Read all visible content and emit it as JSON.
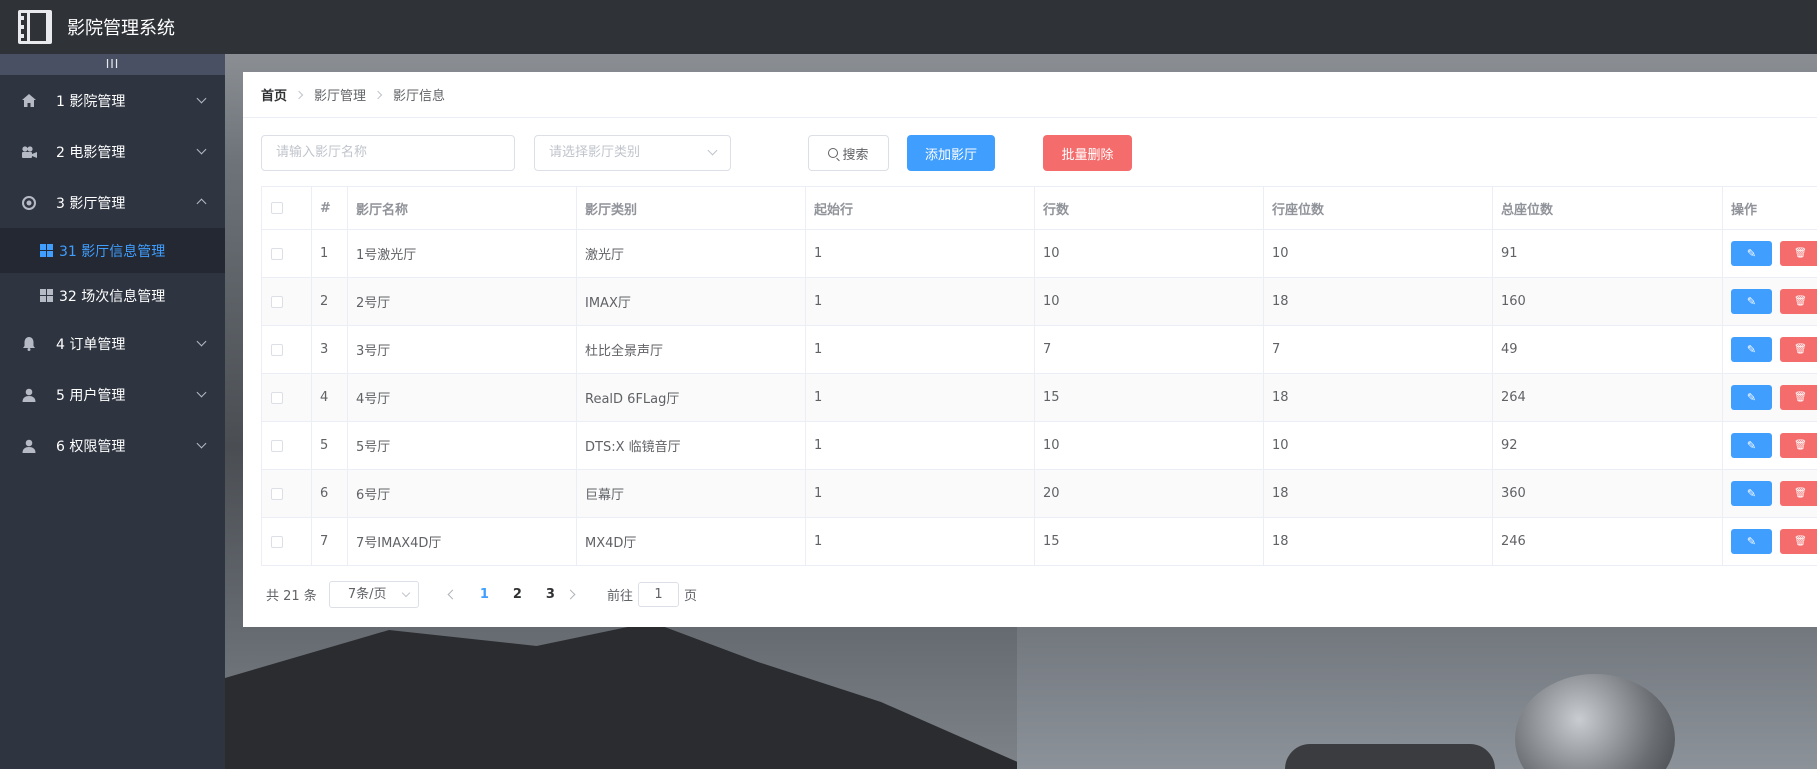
{
  "app": {
    "title": "影院管理系统"
  },
  "sidebar": {
    "collapse_label": "III",
    "items": [
      {
        "label": "1 影院管理",
        "icon": "home-icon",
        "expanded": false
      },
      {
        "label": "2 电影管理",
        "icon": "camera-icon",
        "expanded": false
      },
      {
        "label": "3 影厅管理",
        "icon": "circle-dot-icon",
        "expanded": true,
        "children": [
          {
            "label": "31 影厅信息管理",
            "active": true
          },
          {
            "label": "32 场次信息管理",
            "active": false
          }
        ]
      },
      {
        "label": "4 订单管理",
        "icon": "bell-icon",
        "expanded": false
      },
      {
        "label": "5 用户管理",
        "icon": "user-icon",
        "expanded": false
      },
      {
        "label": "6 权限管理",
        "icon": "user-icon",
        "expanded": false
      }
    ]
  },
  "breadcrumb": [
    "首页",
    "影厅管理",
    "影厅信息"
  ],
  "toolbar": {
    "name_placeholder": "请输入影厅名称",
    "type_placeholder": "请选择影厅类别",
    "search_label": "搜索",
    "add_label": "添加影厅",
    "bulk_delete_label": "批量删除"
  },
  "table": {
    "headers": [
      "#",
      "影厅名称",
      "影厅类别",
      "起始行",
      "行数",
      "行座位数",
      "总座位数",
      "操作"
    ],
    "rows": [
      [
        "1",
        "1号激光厅",
        "激光厅",
        "1",
        "10",
        "10",
        "91"
      ],
      [
        "2",
        "2号厅",
        "IMAX厅",
        "1",
        "10",
        "18",
        "160"
      ],
      [
        "3",
        "3号厅",
        "杜比全景声厅",
        "1",
        "7",
        "7",
        "49"
      ],
      [
        "4",
        "4号厅",
        "RealD 6FLag厅",
        "1",
        "15",
        "18",
        "264"
      ],
      [
        "5",
        "5号厅",
        "DTS:X 临镜音厅",
        "1",
        "10",
        "10",
        "92"
      ],
      [
        "6",
        "6号厅",
        "巨幕厅",
        "1",
        "20",
        "18",
        "360"
      ],
      [
        "7",
        "7号IMAX4D厅",
        "MX4D厅",
        "1",
        "15",
        "18",
        "246"
      ]
    ]
  },
  "pagination": {
    "total_label": "共 21 条",
    "page_size": "7条/页",
    "pages": [
      "1",
      "2",
      "3"
    ],
    "current_page": "1",
    "goto_label": "前往",
    "goto_value": "1",
    "page_suffix": "页"
  },
  "colors": {
    "primary": "#409eff",
    "danger": "#f56c6c",
    "sidebar_bg": "#2e3440",
    "topbar_bg": "#2f3338"
  }
}
